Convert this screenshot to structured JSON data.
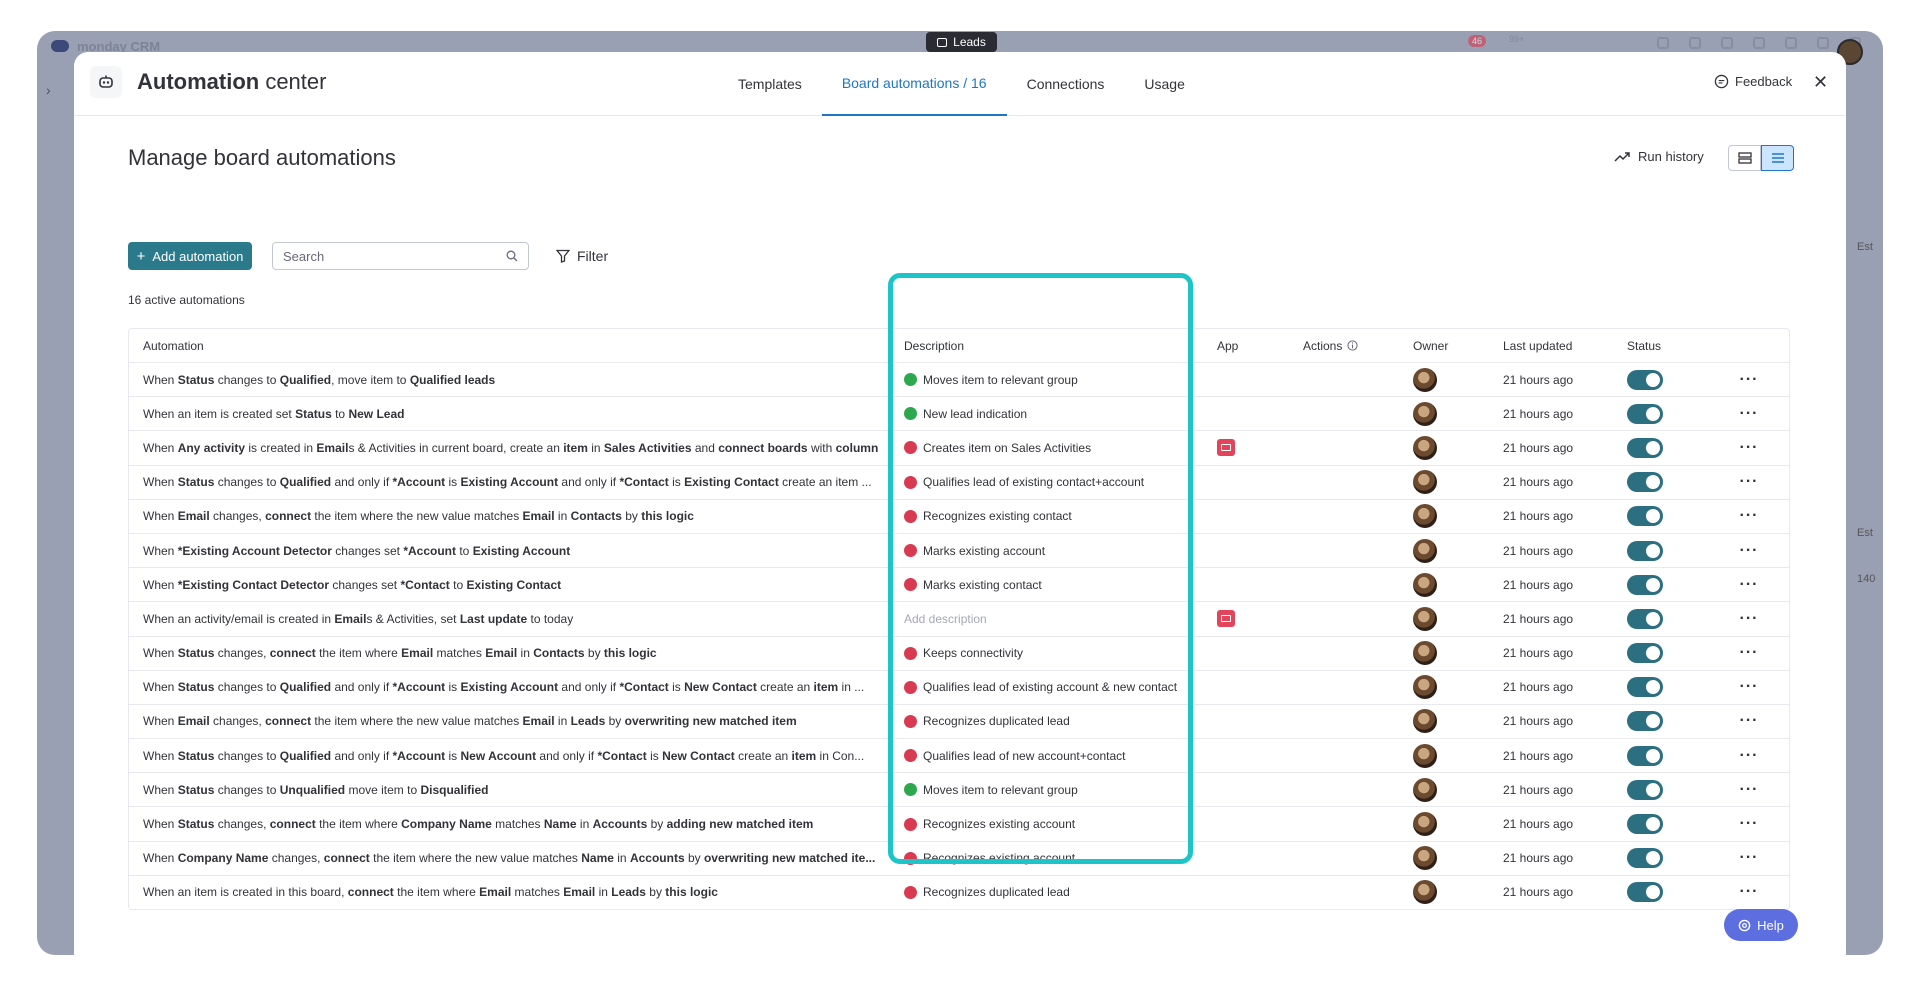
{
  "background": {
    "app_name": "monday CRM",
    "badge_count": "46",
    "badge_more": "99+",
    "right_column_labels": [
      "Est",
      "Est",
      "140"
    ]
  },
  "leads_tag": "Leads",
  "header": {
    "title_bold": "Automation",
    "title_rest": " center",
    "tabs": [
      {
        "label": "Templates"
      },
      {
        "label": "Board automations / 16"
      },
      {
        "label": "Connections"
      },
      {
        "label": "Usage"
      }
    ],
    "feedback_label": "Feedback"
  },
  "page": {
    "title": "Manage board automations",
    "run_history_label": "Run history",
    "add_automation_label": "Add automation",
    "search_placeholder": "Search",
    "filter_label": "Filter",
    "active_count": "16 active automations"
  },
  "table": {
    "headers": {
      "automation": "Automation",
      "description": "Description",
      "app": "App",
      "actions": "Actions",
      "owner": "Owner",
      "last_updated": "Last updated",
      "status": "Status"
    },
    "rows": [
      {
        "automation": "When Status changes to Qualified, move item to Qualified leads",
        "description": "Moves item to relevant group",
        "dot": "green",
        "app": false,
        "updated": "21 hours ago"
      },
      {
        "automation": "When an item is created set Status to New Lead",
        "description": "New lead indication",
        "dot": "green",
        "app": false,
        "updated": "21 hours ago"
      },
      {
        "automation": "When Any activity is created in Emails & Activities in current board, create an item in Sales Activities and connect boards with column",
        "description": "Creates item on Sales Activities",
        "dot": "red",
        "app": true,
        "updated": "21 hours ago"
      },
      {
        "automation": "When Status changes to Qualified and only if *Account is Existing Account and only if *Contact is Existing Contact create an item ...",
        "description": "Qualifies lead of existing contact+account",
        "dot": "red",
        "app": false,
        "updated": "21 hours ago"
      },
      {
        "automation": "When Email changes, connect the item where the new value matches Email in Contacts by this logic",
        "description": "Recognizes existing contact",
        "dot": "red",
        "app": false,
        "updated": "21 hours ago"
      },
      {
        "automation": "When *Existing Account Detector changes set *Account to Existing Account",
        "description": "Marks existing account",
        "dot": "red",
        "app": false,
        "updated": "21 hours ago"
      },
      {
        "automation": "When *Existing Contact Detector changes set *Contact to Existing Contact",
        "description": "Marks existing contact",
        "dot": "red",
        "app": false,
        "updated": "21 hours ago"
      },
      {
        "automation": "When an activity/email is created in Emails & Activities, set Last update to today",
        "description": "Add description",
        "dot": "none",
        "app": true,
        "updated": "21 hours ago"
      },
      {
        "automation": "When Status changes, connect the item where Email matches Email in Contacts by this logic",
        "description": "Keeps connectivity",
        "dot": "red",
        "app": false,
        "updated": "21 hours ago"
      },
      {
        "automation": "When Status changes to Qualified and only if *Account is Existing Account and only if *Contact is New Contact create an item in ...",
        "description": "Qualifies lead of existing account & new contact",
        "dot": "red",
        "app": false,
        "updated": "21 hours ago"
      },
      {
        "automation": "When Email changes, connect the item where the new value matches Email in Leads by overwriting new matched item",
        "description": "Recognizes duplicated lead",
        "dot": "red",
        "app": false,
        "updated": "21 hours ago"
      },
      {
        "automation": "When Status changes to Qualified and only if *Account is New Account and only if *Contact is New Contact create an item in Con...",
        "description": "Qualifies lead of new account+contact",
        "dot": "red",
        "app": false,
        "updated": "21 hours ago"
      },
      {
        "automation": "When Status changes to Unqualified move item to Disqualified",
        "description": "Moves item to relevant group",
        "dot": "green",
        "app": false,
        "updated": "21 hours ago"
      },
      {
        "automation": "When Status changes, connect the item where Company Name matches Name in Accounts by adding new matched item",
        "description": "Recognizes existing account",
        "dot": "red",
        "app": false,
        "updated": "21 hours ago"
      },
      {
        "automation": "When Company Name changes, connect the item where the new value matches Name in Accounts by overwriting new matched ite...",
        "description": "Recognizes existing account",
        "dot": "red",
        "app": false,
        "updated": "21 hours ago"
      },
      {
        "automation": "When an item is created in this board, connect the item where Email matches Email in Leads by this logic",
        "description": "Recognizes duplicated lead",
        "dot": "red",
        "app": false,
        "updated": "21 hours ago"
      }
    ]
  },
  "help_label": "Help",
  "colors": {
    "accent": "#1f76c2",
    "primary_button": "#2b7a8c",
    "highlight": "#1ec4c8",
    "status_green": "#2ea84f",
    "status_red": "#d83a52",
    "help": "#5c6ee0"
  }
}
